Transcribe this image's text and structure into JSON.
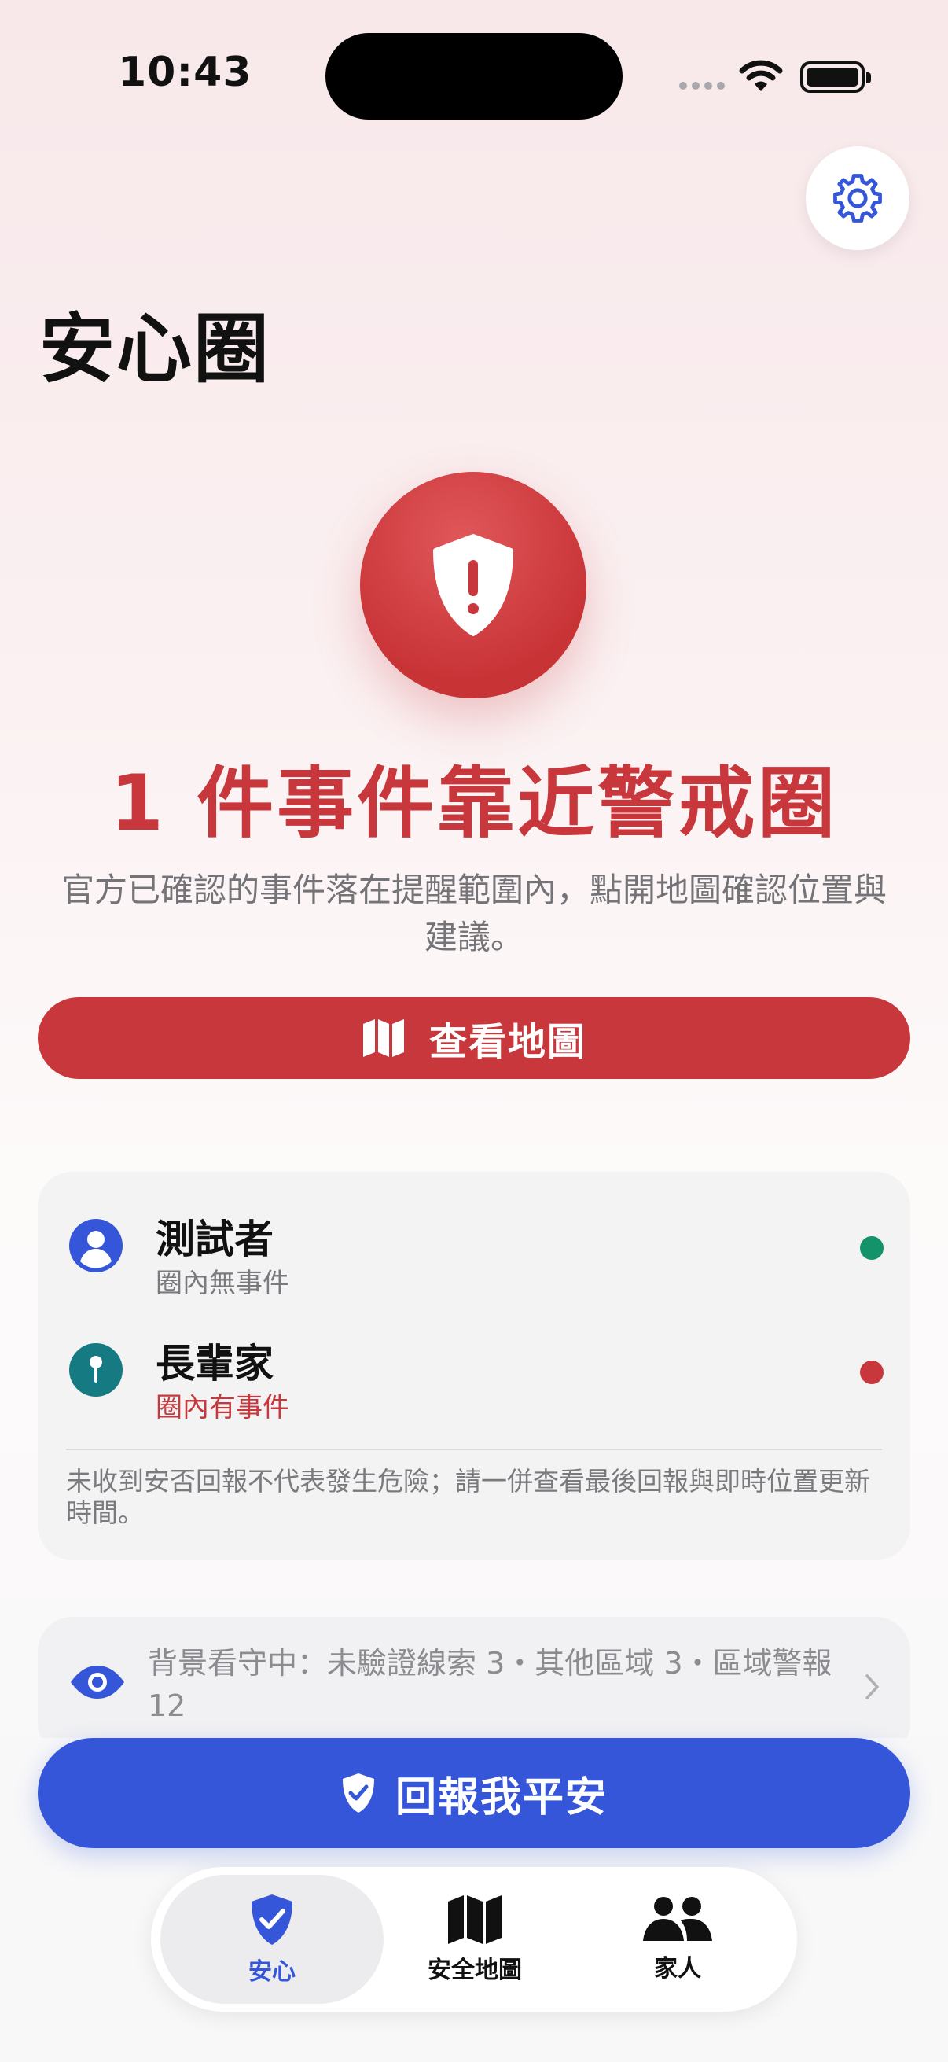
{
  "status_bar": {
    "time": "10:43"
  },
  "header": {
    "title": "安心圈"
  },
  "alert": {
    "headline": "1 件事件靠近警戒圈",
    "description": "官方已確認的事件落在提醒範圍內，點開地圖確認位置與建議。",
    "map_button_label": "查看地圖"
  },
  "members": {
    "items": [
      {
        "name": "測試者",
        "status": "圈內無事件",
        "status_color": "#14936b",
        "icon": "person-icon"
      },
      {
        "name": "長輩家",
        "status": "圈內有事件",
        "status_color": "#c8373b",
        "icon": "pin-icon"
      }
    ],
    "note": "未收到安否回報不代表發生危險；請一併查看最後回報與即時位置更新時間。"
  },
  "background_watch": {
    "text": "背景看守中：未驗證線索 3・其他區域 3・區域警報 12"
  },
  "safe_button_label": "回報我平安",
  "tabs": [
    {
      "label": "安心",
      "icon": "shield-check-icon",
      "active": true
    },
    {
      "label": "安全地圖",
      "icon": "map-icon",
      "active": false
    },
    {
      "label": "家人",
      "icon": "people-icon",
      "active": false
    }
  ],
  "colors": {
    "alert_red": "#c8373b",
    "primary_blue": "#3556d8",
    "ok_green": "#14936b"
  }
}
